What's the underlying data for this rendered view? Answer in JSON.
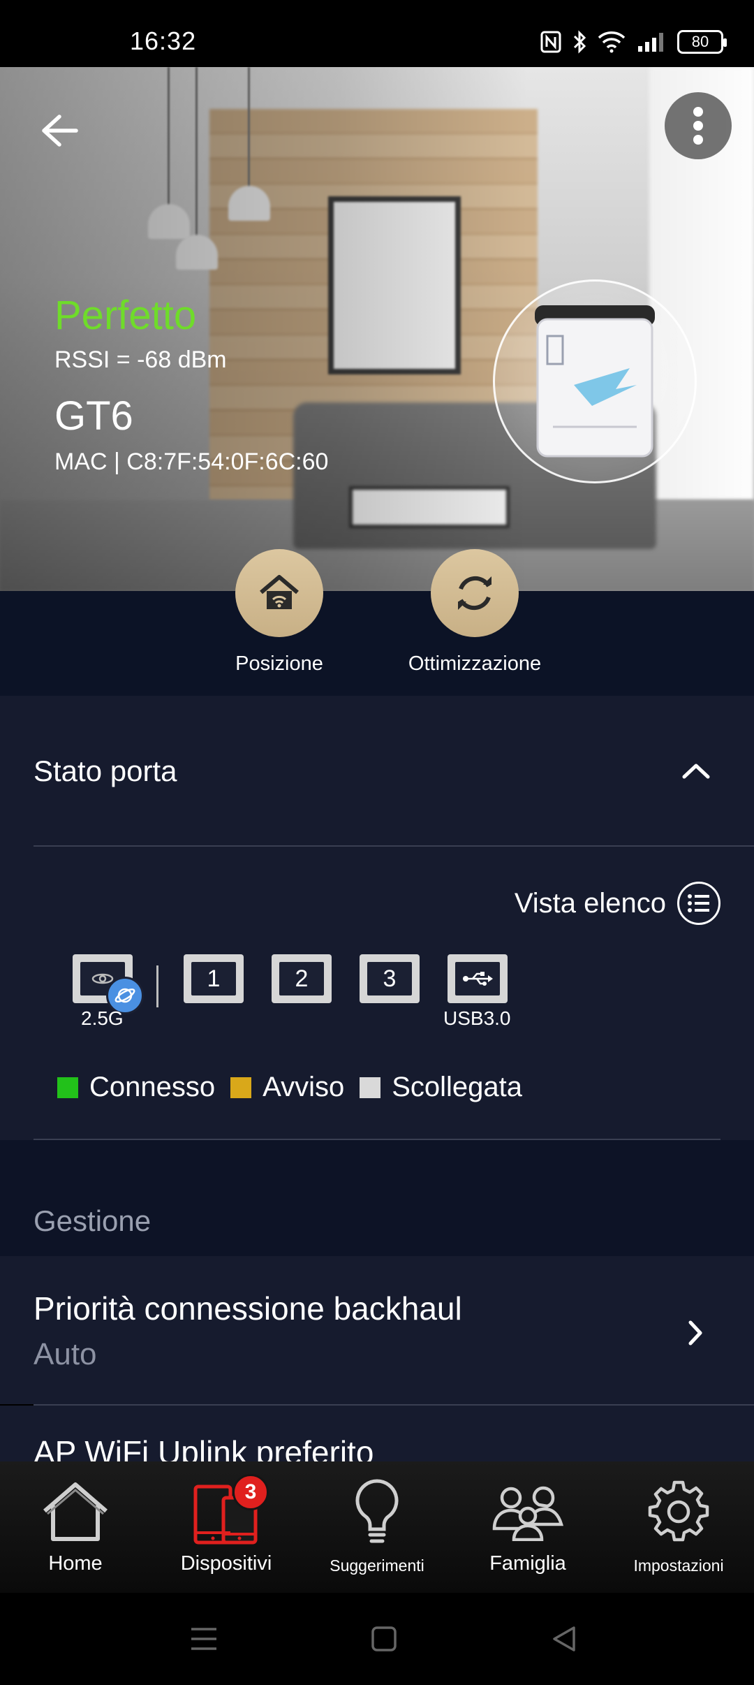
{
  "status_bar": {
    "time": "16:32",
    "battery": "80",
    "icons": [
      "nfc-icon",
      "bluetooth-icon",
      "wifi-icon",
      "signal-icon",
      "battery-icon"
    ]
  },
  "header": {
    "back_icon": "arrow-left-icon",
    "menu_icon": "more-vertical-icon"
  },
  "device": {
    "quality": "Perfetto",
    "quality_color": "#6fdc2a",
    "rssi": "RSSI = -68 dBm",
    "model": "GT6",
    "mac": "MAC  |  C8:7F:54:0F:6C:60"
  },
  "actions": [
    {
      "label": "Posizione",
      "icon": "home-wifi-icon"
    },
    {
      "label": "Ottimizzazione",
      "icon": "refresh-icon"
    }
  ],
  "port_status": {
    "title": "Stato porta",
    "list_view_label": "Vista elenco",
    "wan_caption": "2.5G",
    "ports": [
      "1",
      "2",
      "3"
    ],
    "usb_caption": "USB3.0",
    "legend": [
      {
        "label": "Connesso",
        "color": "#22c11a"
      },
      {
        "label": "Avviso",
        "color": "#d9a81a"
      },
      {
        "label": "Scollegata",
        "color": "#d9d9d9"
      }
    ]
  },
  "management": {
    "title": "Gestione",
    "items": [
      {
        "title": "Priorità connessione backhaul",
        "value": "Auto"
      },
      {
        "title": "AP WiFi Uplink preferito"
      }
    ]
  },
  "bottom_nav": {
    "items": [
      {
        "label": "Home",
        "icon": "home-icon"
      },
      {
        "label": "Dispositivi",
        "icon": "devices-icon",
        "badge": "3",
        "active_color": "#e0201e"
      },
      {
        "label": "Suggerimenti",
        "icon": "lightbulb-icon"
      },
      {
        "label": "Famiglia",
        "icon": "family-icon"
      },
      {
        "label": "Impostazioni",
        "icon": "gear-icon"
      }
    ]
  }
}
